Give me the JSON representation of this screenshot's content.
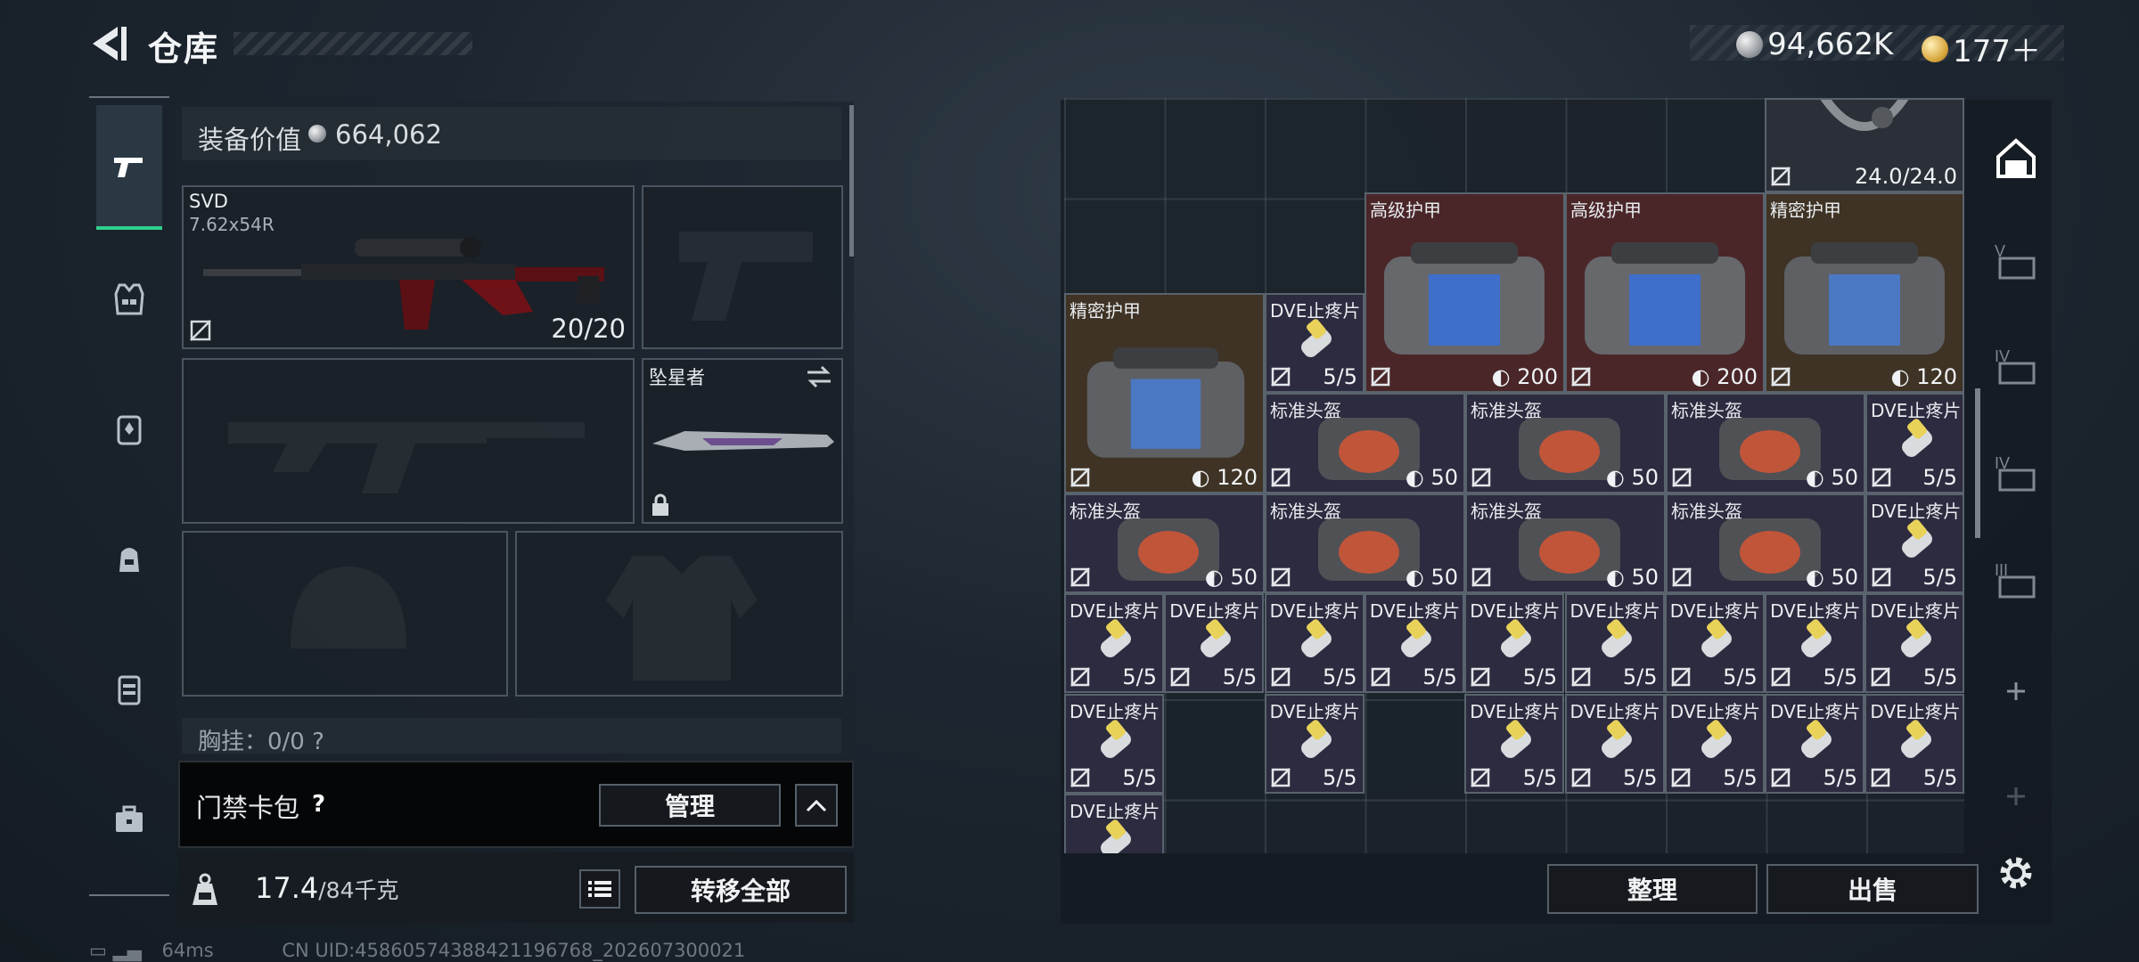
{
  "header": {
    "title": "仓库",
    "silver_amount": "94,662K",
    "gold_amount": "177＋"
  },
  "equipment": {
    "value_label": "装备价值",
    "value_amount": "664,062",
    "primary_weapon": {
      "name": "SVD",
      "caliber": "7.62x54R",
      "ammo": "20/20"
    },
    "melee": {
      "name": "坠星者"
    },
    "chest_rig_partial": "胸挂：0/0 ?"
  },
  "access_card": {
    "label": "门禁卡包",
    "help": "?",
    "manage_label": "管理"
  },
  "weight": {
    "current": "17.4",
    "max": "/84千克",
    "transfer_all_label": "转移全部"
  },
  "status": {
    "ping": "64ms",
    "uid": "CN UID:4586057438842119­6768_202607300021"
  },
  "stash": {
    "top_item_count": "24.0/24.0",
    "items": [
      {
        "name": "高级护甲",
        "count": "200"
      },
      {
        "name": "高级护甲",
        "count": "200"
      },
      {
        "name": "精密护甲",
        "count": "120"
      },
      {
        "name": "精密护甲",
        "count": "120"
      },
      {
        "name": "DVE止疼片",
        "count": "5/5"
      },
      {
        "name": "标准头盔",
        "count": "50"
      }
    ],
    "sort_label": "整理",
    "sell_label": "出售"
  },
  "colors": {
    "accent_green": "#2fd18e",
    "rare_red": "#4a2629",
    "epic_gold": "#3f3325",
    "common_purple": "#2c2b3f"
  }
}
